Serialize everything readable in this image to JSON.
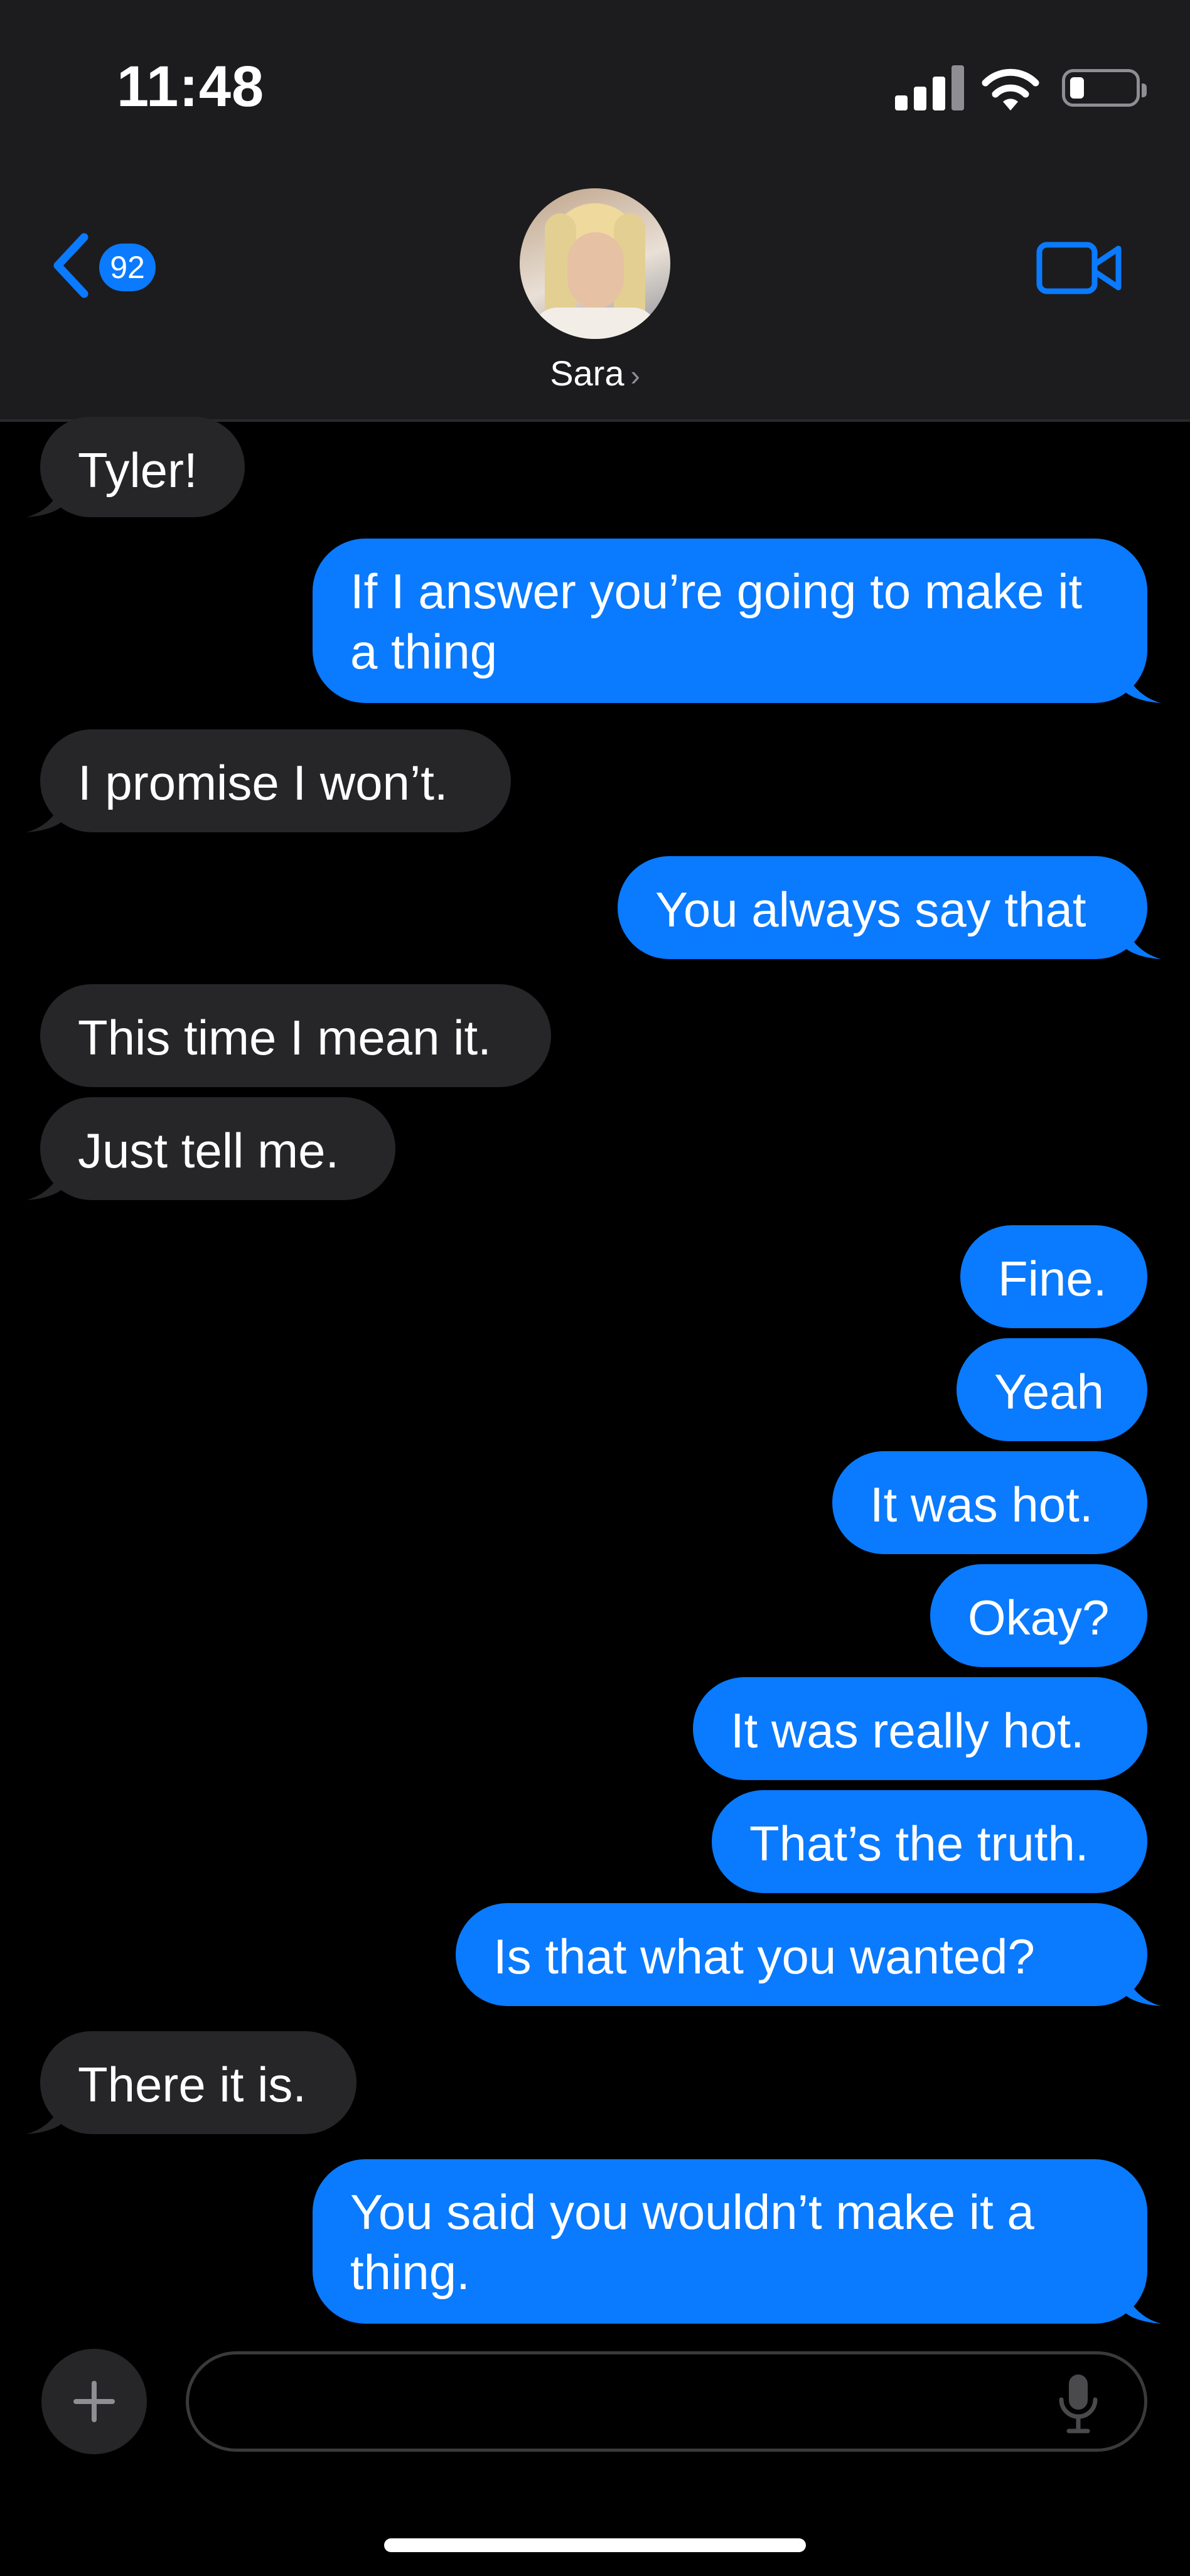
{
  "status_bar": {
    "time": "11:48",
    "battery_level": 0.2,
    "signal_bars": 4
  },
  "header": {
    "back_badge": "92",
    "contact_name": "Sara",
    "accent_color": "#0a7aff"
  },
  "messages": [
    {
      "sender": "contact",
      "text": "Tyler!"
    },
    {
      "sender": "me",
      "text": "If I answer you’re going to make it a thing"
    },
    {
      "sender": "contact",
      "text": "I promise I won’t."
    },
    {
      "sender": "me",
      "text": "You always say that"
    },
    {
      "sender": "contact",
      "text": "This time I mean it."
    },
    {
      "sender": "contact",
      "text": "Just tell me."
    },
    {
      "sender": "me",
      "text": "Fine."
    },
    {
      "sender": "me",
      "text": "Yeah"
    },
    {
      "sender": "me",
      "text": "It was hot."
    },
    {
      "sender": "me",
      "text": "Okay?"
    },
    {
      "sender": "me",
      "text": "It was really hot."
    },
    {
      "sender": "me",
      "text": "That’s the truth."
    },
    {
      "sender": "me",
      "text": "Is that what you wanted?"
    },
    {
      "sender": "contact",
      "text": "There it is."
    },
    {
      "sender": "me",
      "text": "You said you wouldn’t make it a thing."
    }
  ],
  "composer": {
    "placeholder": "",
    "plus_icon": "plus-icon",
    "mic_icon": "microphone-icon"
  },
  "colors": {
    "incoming_bubble": "#262628",
    "outgoing_bubble": "#0a7aff",
    "header_background": "#1c1c1e"
  }
}
